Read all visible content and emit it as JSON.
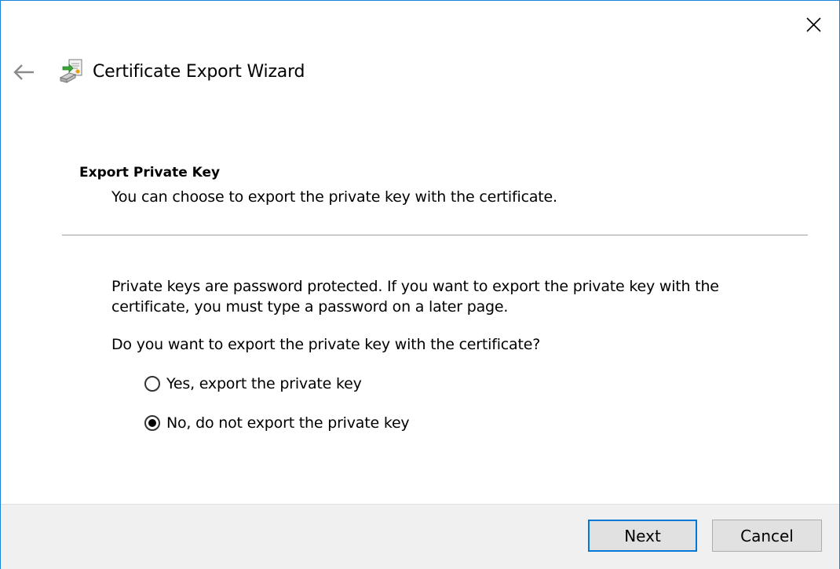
{
  "window": {
    "title": "Certificate Export Wizard",
    "icons": {
      "close": "close-icon",
      "back": "back-arrow-icon",
      "app": "certificate-wizard-icon"
    },
    "accent_color": "#1883d7"
  },
  "page": {
    "heading": "Export Private Key",
    "subtitle": "You can choose to export the private key with the certificate.",
    "description": "Private keys are password protected. If you want to export the private key with the certificate, you must type a password on a later page.",
    "question": "Do you want to export the private key with the certificate?"
  },
  "options": [
    {
      "label": "Yes, export the private key",
      "checked": false
    },
    {
      "label": "No, do not export the private key",
      "checked": true
    }
  ],
  "buttons": {
    "next": "Next",
    "cancel": "Cancel"
  }
}
